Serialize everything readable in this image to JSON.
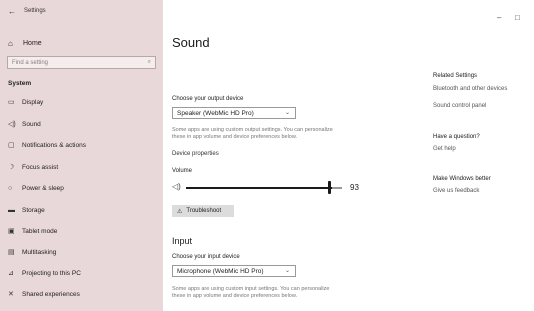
{
  "window": {
    "title": "Settings",
    "minimize": "–",
    "maximize": "□"
  },
  "sidebar": {
    "home_label": "Home",
    "search_placeholder": "Find a setting",
    "section": "System",
    "items": [
      {
        "label": "Display",
        "icon": "display-icon"
      },
      {
        "label": "Sound",
        "icon": "speaker-icon"
      },
      {
        "label": "Notifications & actions",
        "icon": "notifications-icon"
      },
      {
        "label": "Focus assist",
        "icon": "moon-icon"
      },
      {
        "label": "Power & sleep",
        "icon": "power-icon"
      },
      {
        "label": "Storage",
        "icon": "storage-icon"
      },
      {
        "label": "Tablet mode",
        "icon": "tablet-icon"
      },
      {
        "label": "Multitasking",
        "icon": "multitasking-icon"
      },
      {
        "label": "Projecting to this PC",
        "icon": "projecting-icon"
      },
      {
        "label": "Shared experiences",
        "icon": "shared-icon"
      }
    ]
  },
  "main": {
    "title": "Sound",
    "output": {
      "label": "Choose your output device",
      "selected": "Speaker (WebMic HD Pro)",
      "hint_line1": "Some apps are using custom output settings. You can personalize",
      "hint_line2": "these in app volume and device preferences below.",
      "device_properties": "Device properties",
      "volume_label": "Volume",
      "volume_value": "93",
      "volume_level": 0.93,
      "troubleshoot": "Troubleshoot"
    },
    "input": {
      "title": "Input",
      "label": "Choose your input device",
      "selected": "Microphone (WebMic HD Pro)",
      "hint_line1": "Some apps are using custom input settings. You can personalize",
      "hint_line2": "these in app volume and device preferences below."
    }
  },
  "related": {
    "title": "Related Settings",
    "links": [
      "Bluetooth and other devices",
      "Sound control panel"
    ],
    "question_title": "Have a question?",
    "get_help": "Get help",
    "better_title": "Make Windows better",
    "feedback": "Give us feedback"
  }
}
